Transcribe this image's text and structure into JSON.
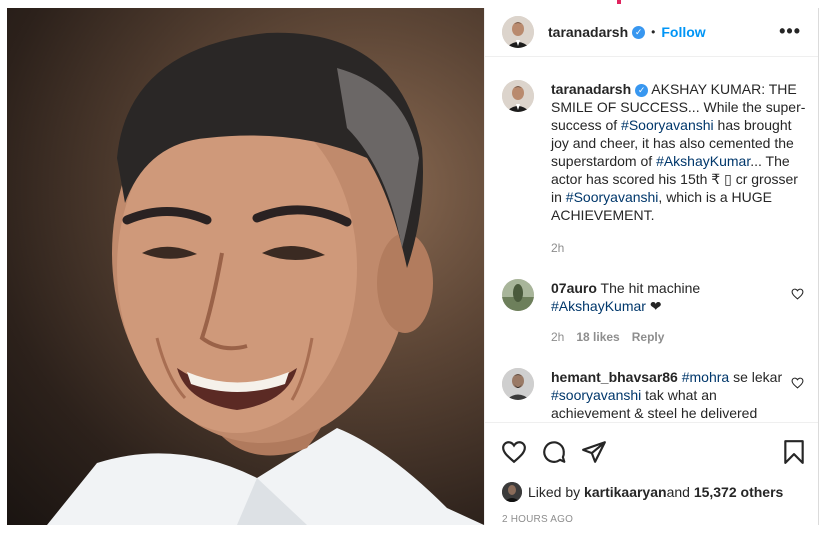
{
  "post": {
    "image_alt": "Portrait photo of a smiling man",
    "author": "taranadarsh",
    "follow_label": "Follow",
    "separator": "•",
    "more_label": "•••",
    "caption": {
      "author": "taranadarsh",
      "text_1": " AKSHAY KUMAR: THE SMILE OF SUCCESS... While the super-success of ",
      "tag_1": "#Sooryavanshi",
      "text_2": " has brought joy and cheer, it has also cemented the superstardom of ",
      "tag_2": "#AkshayKumar",
      "text_3": "... The actor has scored his 15th ₹ ▯ cr grosser in ",
      "tag_3": "#Sooryavanshi",
      "text_4": ", which is a HUGE ACHIEVEMENT.",
      "time": "2h"
    },
    "comments": [
      {
        "user": "07auro",
        "text_1": " The hit machine ",
        "tag_1": "#AkshayKumar",
        "text_2": " ❤",
        "time": "2h",
        "likes": "18 likes",
        "reply": "Reply"
      },
      {
        "user": "hemant_bhavsar86",
        "tag_1": "#mohra",
        "text_1": " se lekar ",
        "tag_2": "#sooryavanshi",
        "text_2": " tak what an achievement & steel he delivered"
      }
    ],
    "likes": {
      "prefix": "Liked by ",
      "user": "kartikaaryan",
      "middle": " and ",
      "count": "15,372 others"
    },
    "posted": "2 HOURS AGO"
  },
  "colors": {
    "link": "#00376b",
    "follow": "#0095f6",
    "verified": "#3897f0",
    "muted": "#8e8e8e"
  },
  "icons": [
    "verified-badge-icon",
    "more-options-icon",
    "heart-icon",
    "comment-icon",
    "share-icon",
    "bookmark-icon",
    "comment-like-heart-icon"
  ]
}
